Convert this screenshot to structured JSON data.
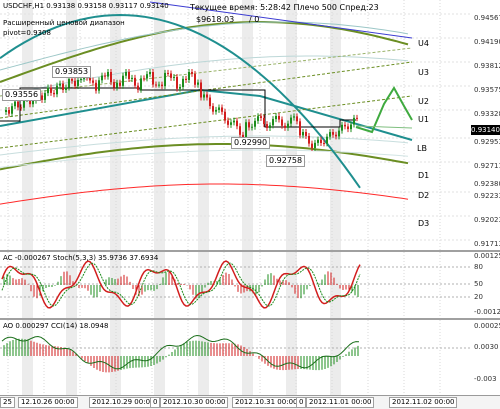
{
  "main": {
    "symbol_line": "USDCHF,H1  0.93138 0.93158 0.93117 0.93140",
    "range_label": "Расширенный ценовой диапазон",
    "pivot_label": "pivot=0.9308",
    "time_label": "Текущее время: 5:28:42 Плечо 500 Спред:23",
    "balance_label": "$9618.03",
    "balance_suffix": "/ 0",
    "levels": {
      "u4": "U4",
      "u3": "U3",
      "u2": "U2",
      "u1": "U1",
      "lb": "LB",
      "d1": "D1",
      "d2": "D2",
      "d3": "D3"
    },
    "peaks": [
      "0.93556",
      "0.93853",
      "0.92990",
      "0.92758"
    ],
    "price_ticks": [
      "0.94567",
      "0.94190",
      "0.93812",
      "0.93575",
      "0.93328",
      "0.92953",
      "0.92711",
      "0.92380",
      "0.92233",
      "0.92023",
      "0.91713"
    ],
    "current_price": "0.93140",
    "colors": {
      "bull": "#1c8c1c",
      "bear": "#d21e1e",
      "olive": "#6b8e23",
      "teal": "#1f8f8f",
      "blue": "#3c3cd2",
      "red_line": "#ff2a2a"
    }
  },
  "stoch": {
    "header": "AC -0.000267  Stoch(5,3,3) 35.9736 37.6934",
    "ticks": [
      "0.001255",
      "80",
      "50",
      "20",
      "-0.00121"
    ]
  },
  "ao": {
    "header": "AO 0.000297  CCI(14) 18.0948",
    "ticks": [
      "0.00025",
      "0.0030",
      "-0.003"
    ]
  },
  "time_axis": [
    "12.10.26 00:00",
    "2012.10.29 00:00",
    "2012.10.30 00:00",
    "2012.10.31 00:00",
    "2012.11.01 00:00",
    "2012.11.02 00:00"
  ],
  "time_axis_partial": [
    "25",
    "0",
    "0"
  ]
}
